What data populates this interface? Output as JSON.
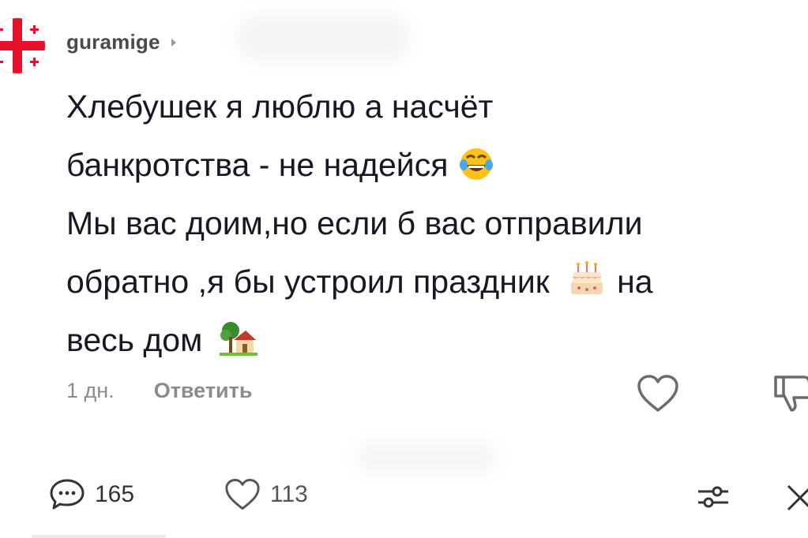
{
  "comment": {
    "username": "guramige",
    "text_lines": [
      "Хлебушек я люблю а насчёт",
      "банкротства - не надейся",
      "Мы вас доим,но если б вас отправили",
      "обратно ,я бы устроил праздник",
      "на",
      "весь дом"
    ],
    "emojis": [
      "laughing-tears-emoji",
      "birthday-cake-emoji",
      "house-with-garden-emoji"
    ],
    "age": "1 дн.",
    "reply_label": "Ответить"
  },
  "footer": {
    "comments_count": "165",
    "likes_count": "113"
  },
  "colors": {
    "text": "#161823",
    "muted": "#8a8b91",
    "background": "#ffffff"
  }
}
